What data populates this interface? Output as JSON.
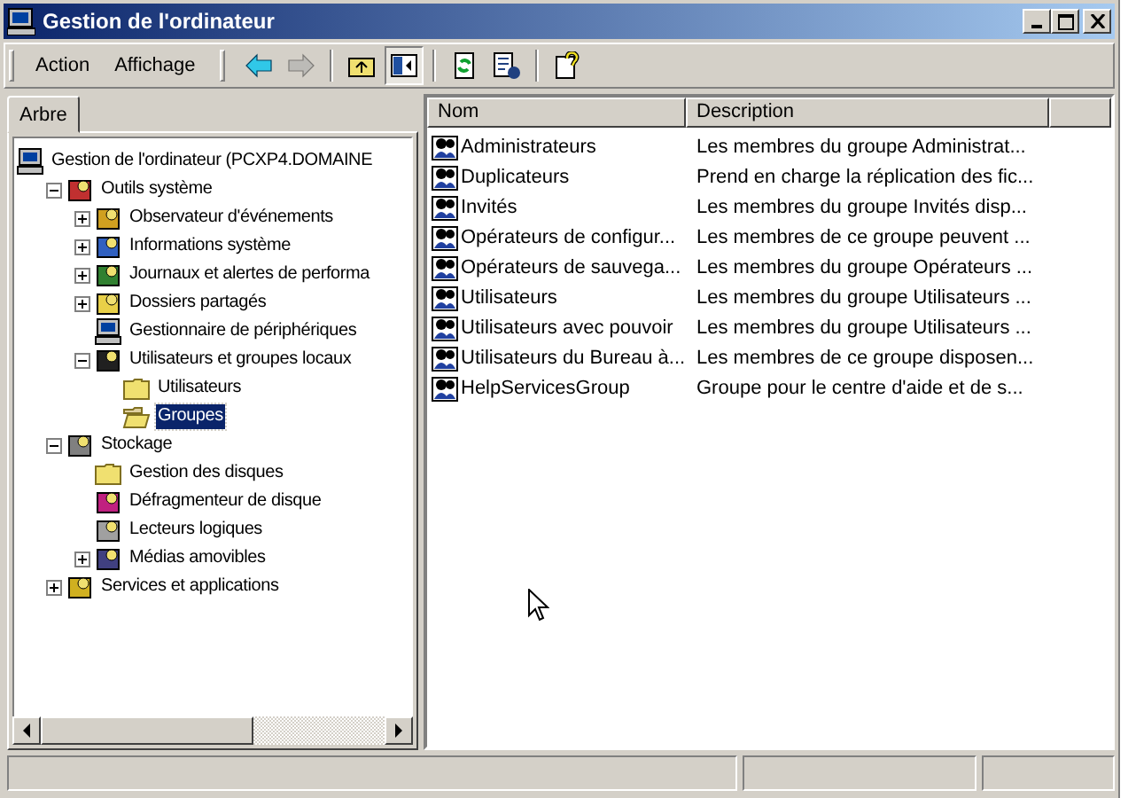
{
  "window": {
    "title": "Gestion de l'ordinateur"
  },
  "menu": [
    "Action",
    "Affichage"
  ],
  "toolbar": [
    {
      "kind": "back",
      "disabled": false,
      "pressed": false
    },
    {
      "kind": "forward",
      "disabled": true,
      "pressed": false
    },
    {
      "kind": "up",
      "disabled": false,
      "pressed": false
    },
    {
      "kind": "tree",
      "disabled": false,
      "pressed": true
    },
    {
      "kind": "refresh",
      "disabled": false,
      "pressed": false
    },
    {
      "kind": "export",
      "disabled": false,
      "pressed": false
    },
    {
      "kind": "help",
      "disabled": false,
      "pressed": false
    }
  ],
  "tabs": [
    {
      "label": "Arbre",
      "selected": true
    }
  ],
  "tree": [
    {
      "label": "Gestion de l'ordinateur (PCXP4.DOMAINE",
      "kind": "computer",
      "selected": false,
      "children": [
        {
          "label": "Outils système",
          "kind": "tools",
          "selected": false,
          "expanded": true,
          "children": [
            {
              "label": "Observateur d'événements",
              "kind": "viewer",
              "selected": false,
              "expanded": false
            },
            {
              "label": "Informations système",
              "kind": "info",
              "selected": false,
              "expanded": false
            },
            {
              "label": "Journaux et alertes de performa",
              "kind": "perf",
              "selected": false,
              "expanded": false
            },
            {
              "label": "Dossiers partagés",
              "kind": "share",
              "selected": false,
              "expanded": false
            },
            {
              "label": "Gestionnaire de périphériques",
              "kind": "computer",
              "selected": false
            },
            {
              "label": "Utilisateurs et groupes locaux",
              "kind": "users",
              "selected": false,
              "expanded": true,
              "children": [
                {
                  "label": "Utilisateurs",
                  "kind": "folder",
                  "selected": false
                },
                {
                  "label": "Groupes",
                  "kind": "openfolder",
                  "selected": true
                }
              ]
            }
          ]
        },
        {
          "label": "Stockage",
          "kind": "storage",
          "selected": false,
          "expanded": true,
          "children": [
            {
              "label": "Gestion des disques",
              "kind": "folder",
              "selected": false
            },
            {
              "label": "Défragmenteur de disque",
              "kind": "defrag",
              "selected": false
            },
            {
              "label": "Lecteurs logiques",
              "kind": "drive",
              "selected": false
            },
            {
              "label": "Médias amovibles",
              "kind": "media",
              "selected": false,
              "expanded": false
            }
          ]
        },
        {
          "label": "Services et applications",
          "kind": "services",
          "selected": false,
          "expanded": false
        }
      ]
    }
  ],
  "list": {
    "columns": [
      "Nom",
      "Description"
    ],
    "rows": [
      {
        "name": "Administrateurs",
        "description": "Les membres du groupe Administrat..."
      },
      {
        "name": "Duplicateurs",
        "description": "Prend en charge la réplication des fic..."
      },
      {
        "name": "Invités",
        "description": "Les membres du groupe Invités disp..."
      },
      {
        "name": "Opérateurs de configur...",
        "description": "Les membres de ce groupe peuvent ..."
      },
      {
        "name": "Opérateurs de sauvega...",
        "description": "Les membres du groupe Opérateurs ..."
      },
      {
        "name": "Utilisateurs",
        "description": "Les membres du groupe Utilisateurs ..."
      },
      {
        "name": "Utilisateurs avec pouvoir",
        "description": "Les membres du groupe Utilisateurs ..."
      },
      {
        "name": "Utilisateurs du Bureau à...",
        "description": "Les membres de ce groupe disposen..."
      },
      {
        "name": "HelpServicesGroup",
        "description": "Groupe pour le centre d'aide et de s..."
      }
    ]
  }
}
